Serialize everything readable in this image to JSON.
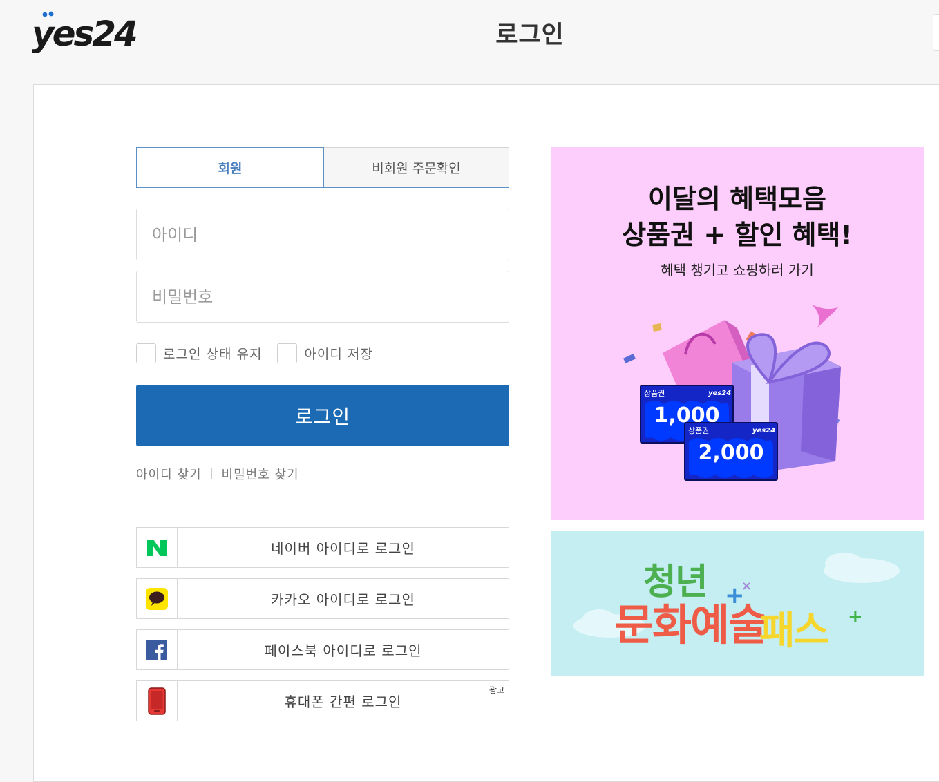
{
  "header": {
    "title": "로그인"
  },
  "login": {
    "tabs": [
      {
        "label": "회원",
        "active": true
      },
      {
        "label": "비회원 주문확인",
        "active": false
      }
    ],
    "id_placeholder": "아이디",
    "pw_placeholder": "비밀번호",
    "keep_login_label": "로그인 상태 유지",
    "save_id_label": "아이디 저장",
    "login_button": "로그인",
    "find_id": "아이디 찾기",
    "find_pw": "비밀번호 찾기",
    "social": [
      {
        "label": "네이버 아이디로 로그인",
        "icon": "naver-icon"
      },
      {
        "label": "카카오 아이디로 로그인",
        "icon": "kakao-icon"
      },
      {
        "label": "페이스북 아이디로 로그인",
        "icon": "facebook-icon"
      },
      {
        "label": "휴대폰 간편 로그인",
        "icon": "phone-icon",
        "ad": "광고"
      }
    ]
  },
  "banners": {
    "benefit": {
      "title_line1": "이달의 혜택모음",
      "title_line2": "상품권 + 할인 혜택!",
      "subtitle": "혜택 챙기고 쇼핑하러 가기",
      "voucher1_label": "상품권",
      "voucher1_amount": "1,000",
      "voucher2_label": "상품권",
      "voucher2_amount": "2,000",
      "voucher_brand": "yes24",
      "background": "#fdcdfb"
    },
    "culture_pass": {
      "word1": "청년",
      "word2": "문화예술",
      "word3": "패스",
      "background": "#c4eef2"
    }
  },
  "colors": {
    "primary": "#1d6ab4",
    "tab_active": "#4a7fbe",
    "naver": "#03c75a",
    "kakao": "#fee500",
    "facebook": "#1877f2",
    "phone": "#e53935"
  }
}
